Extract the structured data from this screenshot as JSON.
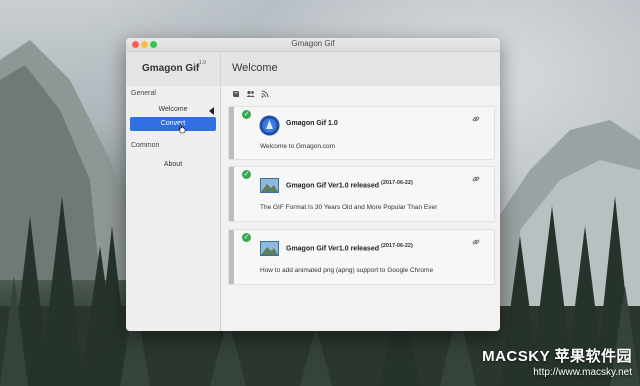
{
  "window": {
    "title": "Gmagon Gif"
  },
  "header": {
    "app_name": "Gmagon Gif",
    "app_version": "1.0",
    "page_title": "Welcome"
  },
  "sidebar": {
    "groups": [
      {
        "title": "General",
        "items": [
          {
            "label": "Welcome",
            "state": "caret"
          },
          {
            "label": "Convert",
            "state": "selected"
          }
        ]
      },
      {
        "title": "Common",
        "items": [
          {
            "label": "About"
          }
        ]
      }
    ]
  },
  "toolbar": {
    "icons": [
      "book-icon",
      "users-icon",
      "rss-icon"
    ]
  },
  "cards": [
    {
      "title": "Gmagon Gif 1.0",
      "date": "",
      "text": "Welcome to Gmagon.com",
      "icon": "app-logo-icon"
    },
    {
      "title": "Gmagon Gif Ver1.0 released",
      "date": "(2017-06-22)",
      "text": "The GIF Format Is 30 Years Old and More Popular Than Ever",
      "icon": "photo-icon"
    },
    {
      "title": "Gmagon Gif Ver1.0 released",
      "date": "(2017-06-22)",
      "text": "How to add animated png (apng) support to Google Chrome",
      "icon": "photo-icon"
    }
  ],
  "watermark": {
    "main": "MACSKY 苹果软件园",
    "url": "http://www.macsky.net"
  },
  "colors": {
    "accent": "#2f6fe0",
    "check": "#35a852"
  }
}
